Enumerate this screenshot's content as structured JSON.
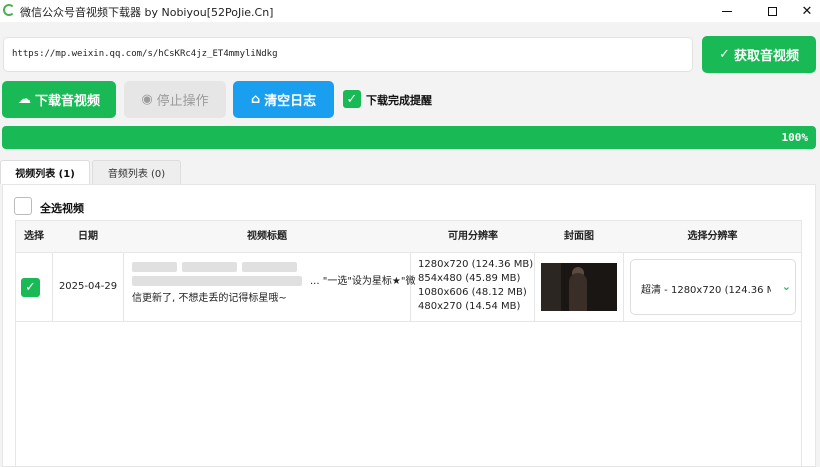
{
  "window": {
    "title": "微信公众号音视频下载器 by Nobiyou[52PoJie.Cn]",
    "minimize_icon": "minimize-icon",
    "maximize_icon": "maximize-icon",
    "close_icon": "close-icon",
    "close_glyph": "✕"
  },
  "url": {
    "value": "https://mp.weixin.qq.com/s/hCsKRc4jz_ET4mmyliNdkg"
  },
  "toolbar": {
    "fetch_label": "获取音视频",
    "fetch_icon": "✓",
    "download_label": "下载音视频",
    "download_icon": "☁",
    "stop_label": "停止操作",
    "stop_icon": "◉",
    "clear_label": "清空日志",
    "clear_icon": "⌂",
    "notify_checked": true,
    "notify_label": "下载完成提醒",
    "check_glyph": "✓"
  },
  "progress": {
    "percent": 100,
    "label": "100%"
  },
  "tabs": [
    {
      "label": "视频列表 (1)",
      "active": true
    },
    {
      "label": "音频列表 (0)",
      "active": false
    }
  ],
  "list": {
    "select_all_label": "全选视频",
    "select_all_checked": false,
    "columns": [
      "选择",
      "日期",
      "视频标题",
      "可用分辨率",
      "封面图",
      "选择分辨率"
    ],
    "rows": [
      {
        "checked": true,
        "date": "2025-04-29",
        "title_tail": "... \"一选\"设为星标★\"微",
        "title_line2": "信更新了, 不想走丢的记得标星哦~",
        "resolutions": [
          "1280x720 (124.36 MB)",
          "854x480 (45.89 MB)",
          "1080x606 (48.12 MB)",
          "480x270 (14.54 MB)"
        ],
        "selected_resolution": "超清 - 1280x720 (124.36 M"
      }
    ]
  },
  "colors": {
    "accent_green": "#19b955",
    "accent_blue": "#1a9ff0",
    "disabled_gray": "#e6e6e6"
  }
}
